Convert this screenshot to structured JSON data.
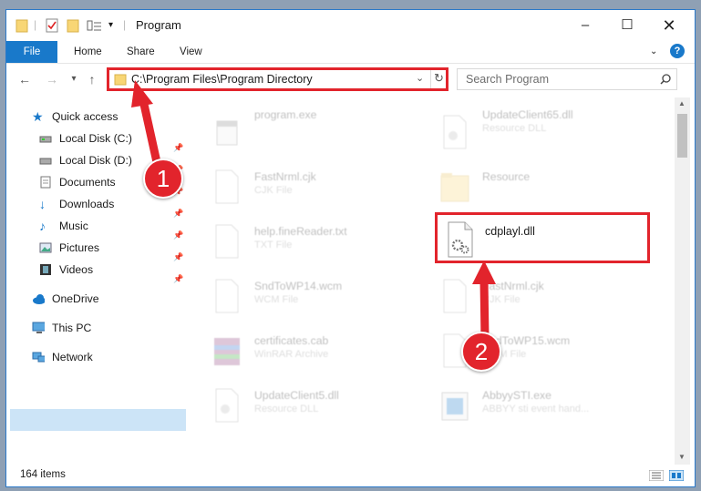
{
  "window": {
    "title": "Program"
  },
  "ribbon": {
    "tabs": [
      "File",
      "Home",
      "Share",
      "View"
    ]
  },
  "address": {
    "path": "C:\\Program Files\\Program Directory"
  },
  "search": {
    "placeholder": "Search Program"
  },
  "sidebar": {
    "items": [
      {
        "label": "Quick access",
        "icon": "star-icon"
      },
      {
        "label": "Local Disk (C:)",
        "icon": "drive-icon",
        "pinned": true
      },
      {
        "label": "Local Disk (D:)",
        "icon": "drive-icon",
        "pinned": true
      },
      {
        "label": "Documents",
        "icon": "documents-icon",
        "pinned": true
      },
      {
        "label": "Downloads",
        "icon": "download-icon",
        "pinned": true
      },
      {
        "label": "Music",
        "icon": "music-icon",
        "pinned": true
      },
      {
        "label": "Pictures",
        "icon": "pictures-icon",
        "pinned": true
      },
      {
        "label": "Videos",
        "icon": "videos-icon",
        "pinned": true
      },
      {
        "label": "OneDrive",
        "icon": "cloud-icon"
      },
      {
        "label": "This PC",
        "icon": "computer-icon",
        "selected": true
      },
      {
        "label": "Network",
        "icon": "network-icon"
      }
    ]
  },
  "files": [
    {
      "name": "program.exe",
      "type": "",
      "icon": "exe-icon"
    },
    {
      "name": "UpdateClient65.dll",
      "type": "Resource DLL",
      "icon": "dll-icon"
    },
    {
      "name": "FastNrml.cjk",
      "type": "CJK File",
      "icon": "file-icon"
    },
    {
      "name": "Resource",
      "type": "",
      "icon": "folder-icon"
    },
    {
      "name": "help.fineReader.txt",
      "type": "TXT File",
      "icon": "file-icon"
    },
    {
      "name": "cdplayl.dll",
      "type": "",
      "icon": "dll-icon",
      "highlighted": true
    },
    {
      "name": "SndToWP14.wcm",
      "type": "WCM File",
      "icon": "file-icon"
    },
    {
      "name": "FastNrml.cjk",
      "type": "CJK File",
      "icon": "file-icon"
    },
    {
      "name": "certificates.cab",
      "type": "WinRAR Archive",
      "icon": "archive-icon"
    },
    {
      "name": "SndToWP15.wcm",
      "type": "WCM File",
      "icon": "file-icon"
    },
    {
      "name": "UpdateClient5.dll",
      "type": "Resource DLL",
      "icon": "dll-icon"
    },
    {
      "name": "AbbyySTI.exe",
      "type": "ABBYY sti event hand...",
      "icon": "exe-icon"
    }
  ],
  "status": {
    "item_count": "164 items"
  },
  "annotations": {
    "step1": "1",
    "step2": "2",
    "color": "#e2242c"
  },
  "colors": {
    "accent": "#1979ca",
    "selected": "#cce4f7"
  }
}
